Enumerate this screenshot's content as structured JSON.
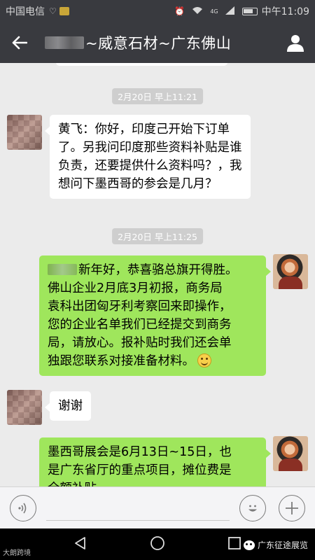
{
  "status_bar": {
    "carrier": "中国电信",
    "time": "中午11:09",
    "network": "4G"
  },
  "header": {
    "title": "~威意石材~广东佛山",
    "back_icon": "arrow-left-icon",
    "profile_icon": "person-icon"
  },
  "messages": [
    {
      "type": "time",
      "text": "2月20日 早上11:21"
    },
    {
      "type": "incoming",
      "lines": [
        "黄飞：你好，印度己开始下订单",
        "了。另我问印度那些资料补贴是谁",
        "负责，还要提供什么资料吗？，我",
        "想问下墨西哥的参会是几月？"
      ]
    },
    {
      "type": "time",
      "text": "2月20日 早上11:25"
    },
    {
      "type": "outgoing",
      "lines": [
        "新年好，恭喜骆总旗开得胜。",
        "佛山企业2月底3月初报，商务局",
        "袁科出团匈牙利考察回来即操作，",
        "您的企业名单我们已经提交到商务",
        "局，请放心。报补贴时我们还会单",
        "独跟您联系对接准备材料。"
      ]
    },
    {
      "type": "incoming",
      "lines": [
        "谢谢"
      ]
    },
    {
      "type": "outgoing",
      "lines": [
        "墨西哥展会是6月13日~15日，也",
        "是广东省厅的重点项目，摊位费是",
        "全额补贴。"
      ]
    }
  ],
  "input_bar": {
    "voice_icon": "voice-icon",
    "emoji_icon": "emoji-icon",
    "plus_icon": "plus-icon"
  },
  "watermarks": {
    "left": "大朗跨境",
    "right": "广东征途展览"
  },
  "colors": {
    "header_bg": "#393a3f",
    "chat_bg": "#ebebeb",
    "outgoing_bubble": "#9fe65c",
    "incoming_bubble": "#ffffff"
  }
}
